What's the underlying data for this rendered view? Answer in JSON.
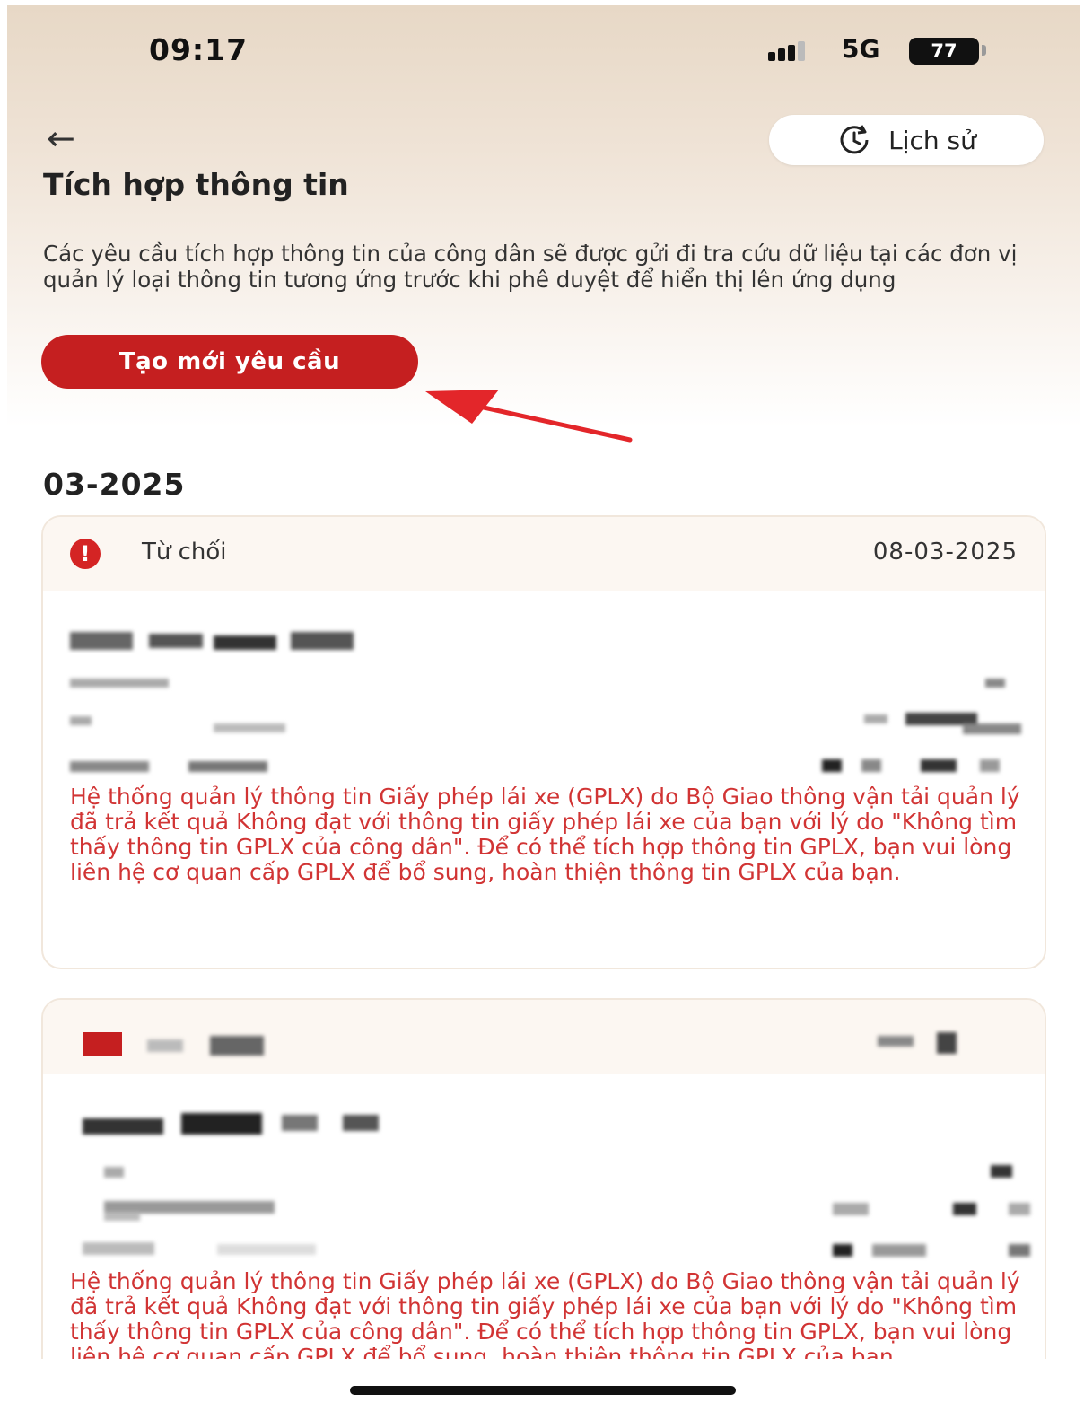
{
  "status_bar": {
    "time": "09:17",
    "network": "5G",
    "battery": "77"
  },
  "header": {
    "history_label": "Lịch sử",
    "title": "Tích hợp thông tin"
  },
  "description": "Các yêu cầu tích hợp thông tin của công dân sẽ được gửi đi tra cứu dữ liệu tại các đơn vị quản lý loại thông tin tương ứng trước khi phê duyệt để hiển thị lên ứng dụng",
  "create_button": "Tạo mới yêu cầu",
  "month_heading": "03-2025",
  "requests": [
    {
      "status": "Từ chối",
      "date": "08-03-2025",
      "note": "Hệ thống quản lý thông tin Giấy phép lái xe (GPLX) do Bộ Giao thông vận tải quản lý đã trả kết quả Không đạt với thông tin giấy phép lái xe của bạn với lý do \"Không tìm thấy thông tin GPLX của công dân\". Để có thể tích hợp thông tin GPLX, bạn vui lòng liên hệ cơ quan cấp GPLX để bổ sung, hoàn thiện thông tin GPLX của bạn."
    },
    {
      "note": "Hệ thống quản lý thông tin Giấy phép lái xe (GPLX) do Bộ Giao thông vận tải quản lý đã trả kết quả Không đạt với thông tin giấy phép lái xe của bạn với lý do \"Không tìm thấy thông tin GPLX của công dân\". Để có thể tích hợp thông tin GPLX, bạn vui lòng liên hệ cơ quan cấp GPLX để bổ sung, hoàn thiện thông tin GPLX của bạn."
    }
  ],
  "colors": {
    "primary": "#c51f20",
    "error_text": "#d13434",
    "annotation_arrow": "#e3262a"
  }
}
